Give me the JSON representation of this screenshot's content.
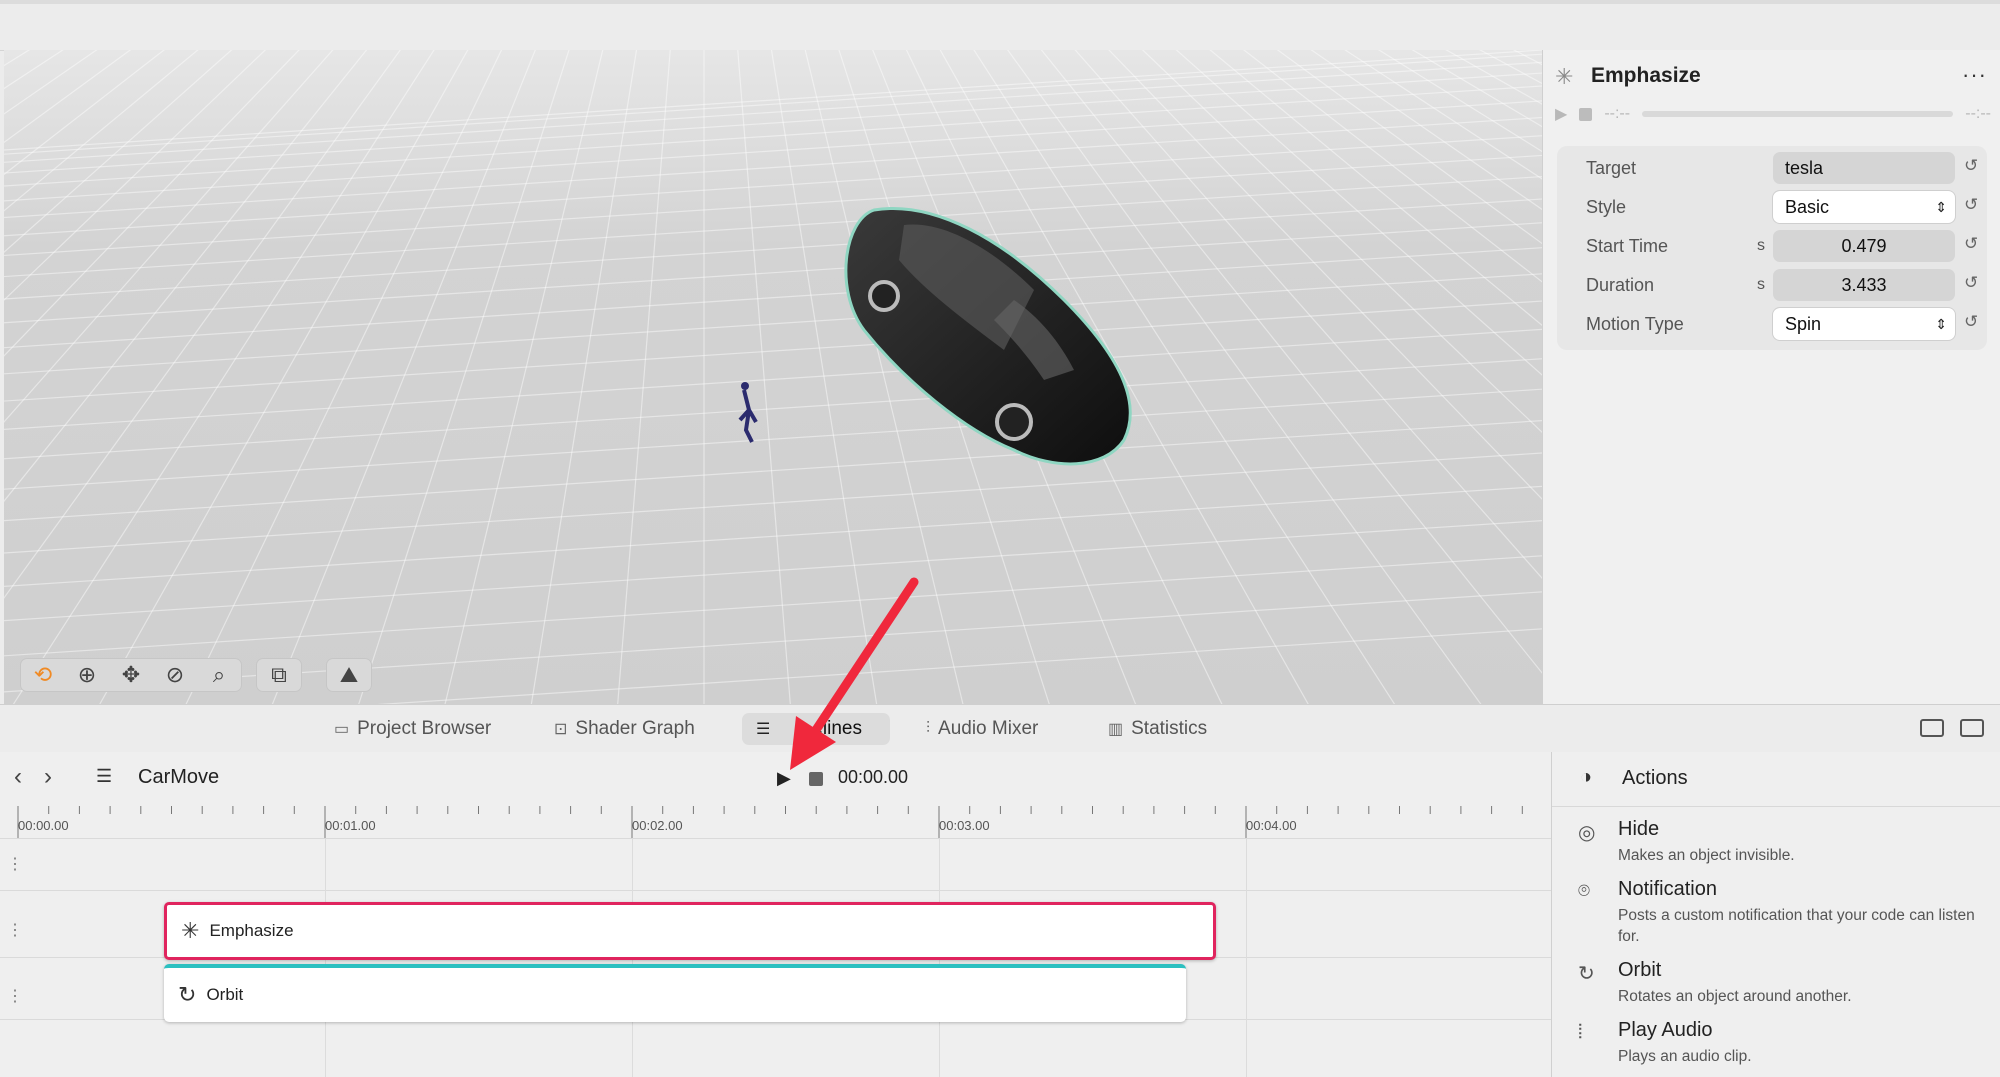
{
  "inspector": {
    "title": "Emphasize",
    "icon": "emphasize-icon",
    "more_label": "···",
    "playback": {
      "start_label": "--:--",
      "end_label": "--:--"
    },
    "properties": [
      {
        "label": "Target",
        "value": "tesla",
        "unit": "",
        "kind": "field"
      },
      {
        "label": "Style",
        "value": "Basic",
        "unit": "",
        "kind": "select"
      },
      {
        "label": "Start Time",
        "value": "0.479",
        "unit": "s",
        "kind": "number"
      },
      {
        "label": "Duration",
        "value": "3.433",
        "unit": "s",
        "kind": "number"
      },
      {
        "label": "Motion Type",
        "value": "Spin",
        "unit": "",
        "kind": "select"
      }
    ]
  },
  "tabs": [
    {
      "label": "Project Browser",
      "icon": "folder-icon"
    },
    {
      "label": "Shader Graph",
      "icon": "nodes-icon"
    },
    {
      "label": "Timelines",
      "icon": "timeline-icon",
      "active": true,
      "visible_label": "elines"
    },
    {
      "label": "Audio Mixer",
      "icon": "sliders-icon"
    },
    {
      "label": "Statistics",
      "icon": "bars-icon"
    }
  ],
  "timeline": {
    "name": "CarMove",
    "current_time": "00:00.00",
    "ruler_labels": [
      "00:00.00",
      "00:01.00",
      "00:02.00",
      "00:03.00",
      "00:04.00"
    ],
    "clips": [
      {
        "label": "Emphasize",
        "icon": "emphasize-icon",
        "selected": true
      },
      {
        "label": "Orbit",
        "icon": "orbit-icon",
        "selected": false
      }
    ]
  },
  "actions": {
    "title": "Actions",
    "items": [
      {
        "name": "Hide",
        "desc": "Makes an object invisible.",
        "icon": "eye-slash-icon"
      },
      {
        "name": "Notification",
        "desc": "Posts a custom notification that your code can listen for.",
        "icon": "broadcast-icon"
      },
      {
        "name": "Orbit",
        "desc": "Rotates an object around another.",
        "icon": "orbit-icon"
      },
      {
        "name": "Play Audio",
        "desc": "Plays an audio clip.",
        "icon": "waveform-icon"
      }
    ]
  },
  "colors": {
    "selection": "#e0245e",
    "accent": "#2cc0c0",
    "annotation": "#f0283c",
    "tool_active": "#f08a24"
  }
}
